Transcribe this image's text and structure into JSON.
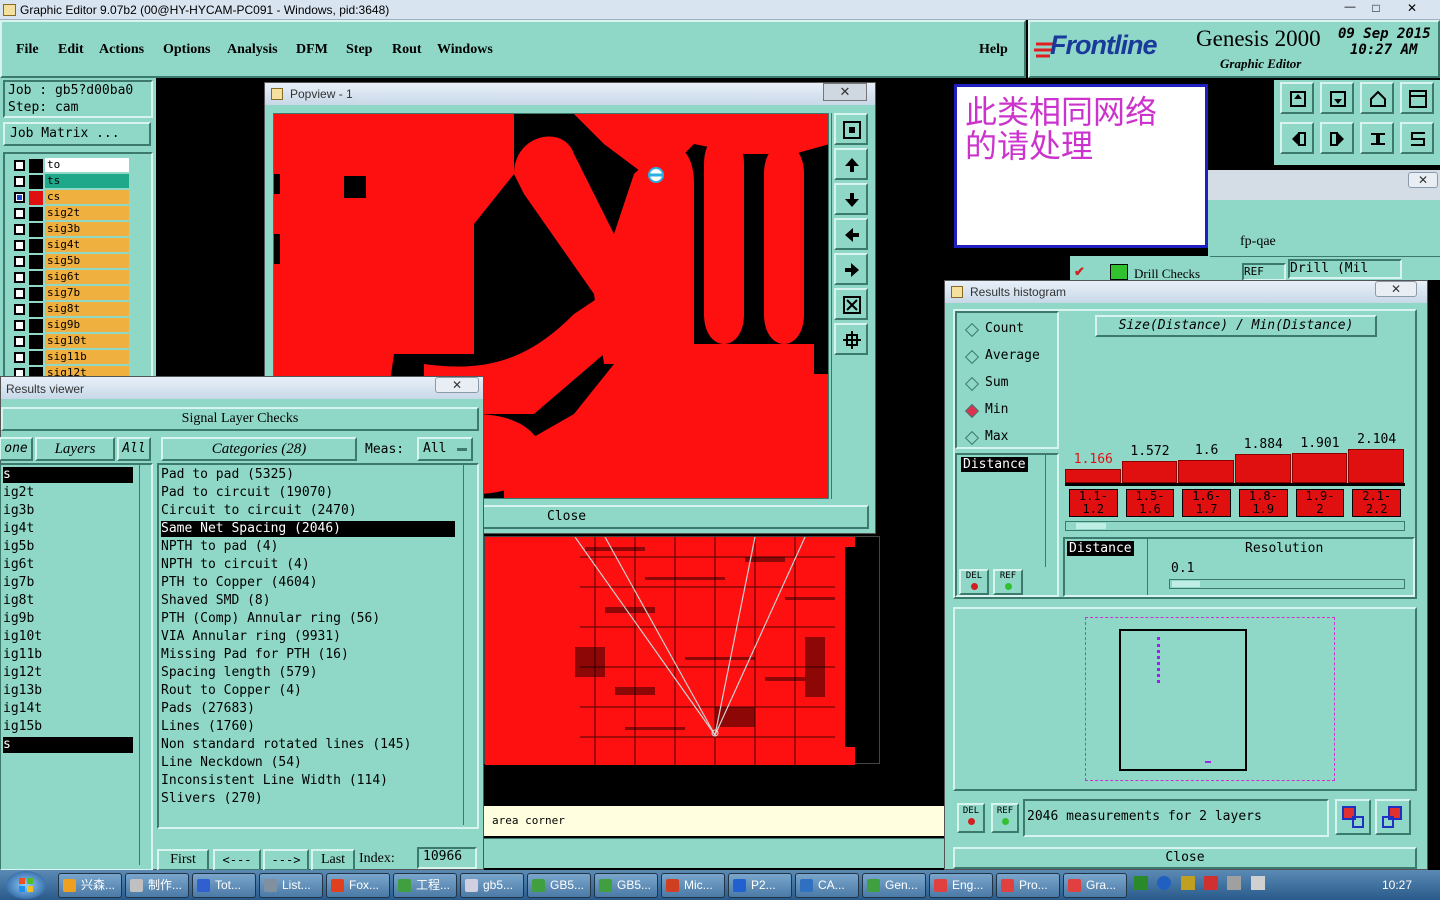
{
  "app": {
    "title": "Graphic Editor 9.07b2 (00@HY-HYCAM-PC091 - Windows, pid:3648)",
    "win_min": "—",
    "win_max": "□",
    "win_close": "✕"
  },
  "menu": {
    "items": [
      "File",
      "Edit",
      "Actions",
      "Options",
      "Analysis",
      "DFM",
      "Step",
      "Rout",
      "Windows"
    ],
    "help": "Help"
  },
  "brand": {
    "logo": "Frontline",
    "product": "Genesis 2000",
    "subtitle": "Graphic Editor",
    "date": "09 Sep 2015",
    "time": "10:27 AM"
  },
  "job": {
    "job_label": "Job : gb5?d00ba0",
    "step_label": "Step: cam",
    "matrix_button": "Job Matrix ..."
  },
  "layers": [
    {
      "name": "to",
      "color": "#ffffff"
    },
    {
      "name": "ts",
      "color": "#1fa88a"
    },
    {
      "name": "cs",
      "color": "#f0b040"
    },
    {
      "name": "sig2t",
      "color": "#f0b040"
    },
    {
      "name": "sig3b",
      "color": "#f0b040"
    },
    {
      "name": "sig4t",
      "color": "#f0b040"
    },
    {
      "name": "sig5b",
      "color": "#f0b040"
    },
    {
      "name": "sig6t",
      "color": "#f0b040"
    },
    {
      "name": "sig7b",
      "color": "#f0b040"
    },
    {
      "name": "sig8t",
      "color": "#f0b040"
    },
    {
      "name": "sig9b",
      "color": "#f0b040"
    },
    {
      "name": "sig10t",
      "color": "#f0b040"
    },
    {
      "name": "sig11b",
      "color": "#f0b040"
    },
    {
      "name": "sig12t",
      "color": "#f0b040"
    }
  ],
  "popview": {
    "title": "Popview - 1",
    "close": "Close"
  },
  "note": {
    "line1": "此类相同网络",
    "line2": "的请处理"
  },
  "fpqae": {
    "title": "fp-qae",
    "drill_checks": "Drill Checks",
    "ref": "REF",
    "drill_mil": "Drill (Mil"
  },
  "results_viewer": {
    "title": "Results viewer",
    "heading": "Signal Layer Checks",
    "none_tab": "one",
    "layers_tab": "Layers",
    "all_tab": "All",
    "categories_tab": "Categories (28)",
    "meas_label": "Meas:",
    "meas_value": "All",
    "layer_list": [
      "s",
      "ig2t",
      "ig3b",
      "ig4t",
      "ig5b",
      "ig6t",
      "ig7b",
      "ig8t",
      "ig9b",
      "ig10t",
      "ig11b",
      "ig12t",
      "ig13b",
      "ig14t",
      "ig15b",
      "s"
    ],
    "categories": [
      "Pad to pad (5325)",
      "Pad to circuit (19070)",
      "Circuit to circuit (2470)",
      "Same Net Spacing (2046)",
      "NPTH to pad (4)",
      "NPTH to circuit (4)",
      "PTH to Copper (4604)",
      "Shaved SMD (8)",
      "PTH (Comp) Annular ring (56)",
      "VIA Annular ring (9931)",
      "Missing Pad for PTH (16)",
      "Spacing length (579)",
      "Rout to Copper (4)",
      "Pads (27683)",
      "Lines (1760)",
      "Non standard rotated lines (145)",
      "Line Neckdown (54)",
      "Inconsistent Line Width (114)",
      "Slivers (270)"
    ],
    "first": "First",
    "prev": "<---",
    "next": "--->",
    "last": "Last",
    "index_label": "Index:",
    "index_value": "10966"
  },
  "status_line": "area corner",
  "histogram": {
    "title": "Results histogram",
    "heading": "Size(Distance) / Min(Distance)",
    "modes": [
      "Count",
      "Average",
      "Sum",
      "Min",
      "Max"
    ],
    "selected_mode": "Min",
    "attr_item": "Distance",
    "del": "DEL",
    "ref": "REF",
    "attr_item2": "Distance",
    "resolution_label": "Resolution",
    "resolution_value": "0.1",
    "summary": "2046 measurements for 2 layers",
    "close": "Close"
  },
  "chart_data": {
    "type": "bar",
    "title": "Size(Distance) / Min(Distance)",
    "categories": [
      "1.1-1.2",
      "1.5-1.6",
      "1.6-1.7",
      "1.8-1.9",
      "1.9-2",
      "2.1-2.2"
    ],
    "bin_labels": [
      [
        "1.1-",
        "1.2"
      ],
      [
        "1.5-",
        "1.6"
      ],
      [
        "1.6-",
        "1.7"
      ],
      [
        "1.8-",
        "1.9"
      ],
      [
        "1.9-",
        "2"
      ],
      [
        "2.1-",
        "2.2"
      ]
    ],
    "values": [
      1.166,
      1.572,
      1.6,
      1.884,
      1.901,
      2.104
    ],
    "value_labels": [
      "1.166",
      "1.572",
      "1.6",
      "1.884",
      "1.901",
      "2.104"
    ],
    "highlight_index": 0,
    "ylim": [
      0,
      2.2
    ]
  },
  "taskbar": {
    "items": [
      "兴森...",
      "制作...",
      "Tot...",
      "List...",
      "Fox...",
      "工程...",
      "gb5...",
      "GB5...",
      "GB5...",
      "Mic...",
      "P2...",
      "CA...",
      "Gen...",
      "Eng...",
      "Pro...",
      "Gra..."
    ],
    "clock": "10:27"
  }
}
